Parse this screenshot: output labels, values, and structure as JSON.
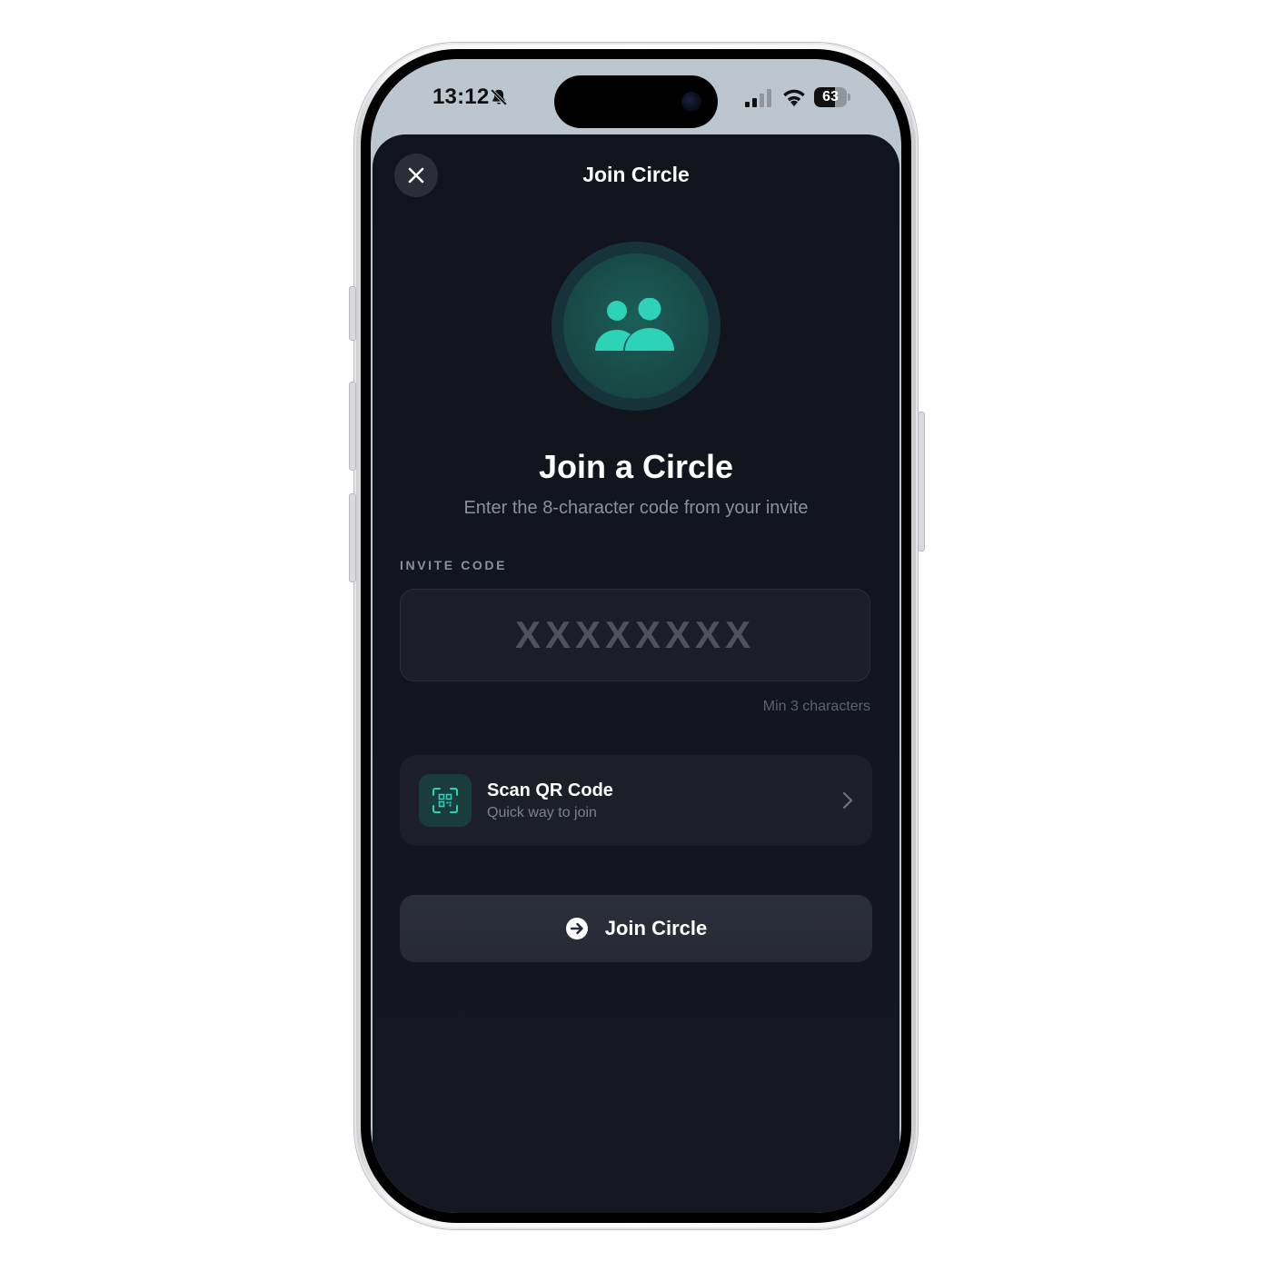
{
  "status_bar": {
    "time": "13:12",
    "battery_level": "63",
    "battery_fraction": 0.63,
    "icons": [
      "bell-slash-icon",
      "signal-icon",
      "wifi-icon",
      "battery-icon"
    ]
  },
  "header": {
    "title": "Join Circle",
    "close_icon": "close-icon"
  },
  "hero": {
    "icon": "people-icon",
    "heading": "Join a Circle",
    "subheading": "Enter the 8-character code from your invite"
  },
  "invite_code": {
    "label": "INVITE CODE",
    "value": "",
    "placeholder": "XXXXXXXX",
    "hint": "Min 3 characters"
  },
  "qr_option": {
    "icon": "qr-code-icon",
    "title": "Scan QR Code",
    "subtitle": "Quick way to join"
  },
  "primary_action": {
    "icon": "arrow-right-circle-icon",
    "label": "Join Circle"
  },
  "colors": {
    "accent": "#2ed3b7",
    "sheet_background": "#12141e",
    "surface": "#1c1e28",
    "status_bar_background": "#bcc6cf"
  }
}
